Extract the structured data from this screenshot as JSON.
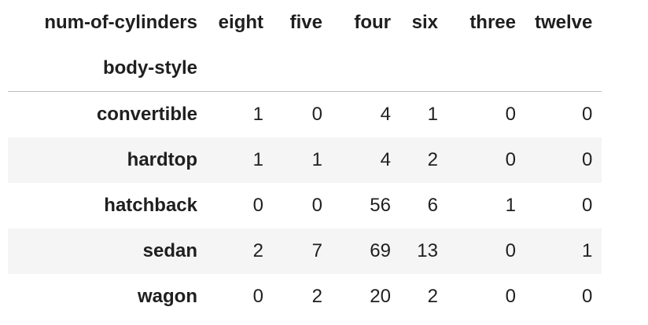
{
  "table": {
    "columns_name": "num-of-cylinders",
    "index_name": "body-style",
    "columns": [
      "eight",
      "five",
      "four",
      "six",
      "three",
      "twelve"
    ],
    "rows": [
      {
        "label": "convertible",
        "values": [
          "1",
          "0",
          "4",
          "1",
          "0",
          "0"
        ]
      },
      {
        "label": "hardtop",
        "values": [
          "1",
          "1",
          "4",
          "2",
          "0",
          "0"
        ]
      },
      {
        "label": "hatchback",
        "values": [
          "0",
          "0",
          "56",
          "6",
          "1",
          "0"
        ]
      },
      {
        "label": "sedan",
        "values": [
          "2",
          "7",
          "69",
          "13",
          "0",
          "1"
        ]
      },
      {
        "label": "wagon",
        "values": [
          "0",
          "2",
          "20",
          "2",
          "0",
          "0"
        ]
      }
    ]
  },
  "colors": {
    "text": "#1f1f1f",
    "stripe": "#f5f5f5",
    "header_rule": "#bdbdbd"
  }
}
